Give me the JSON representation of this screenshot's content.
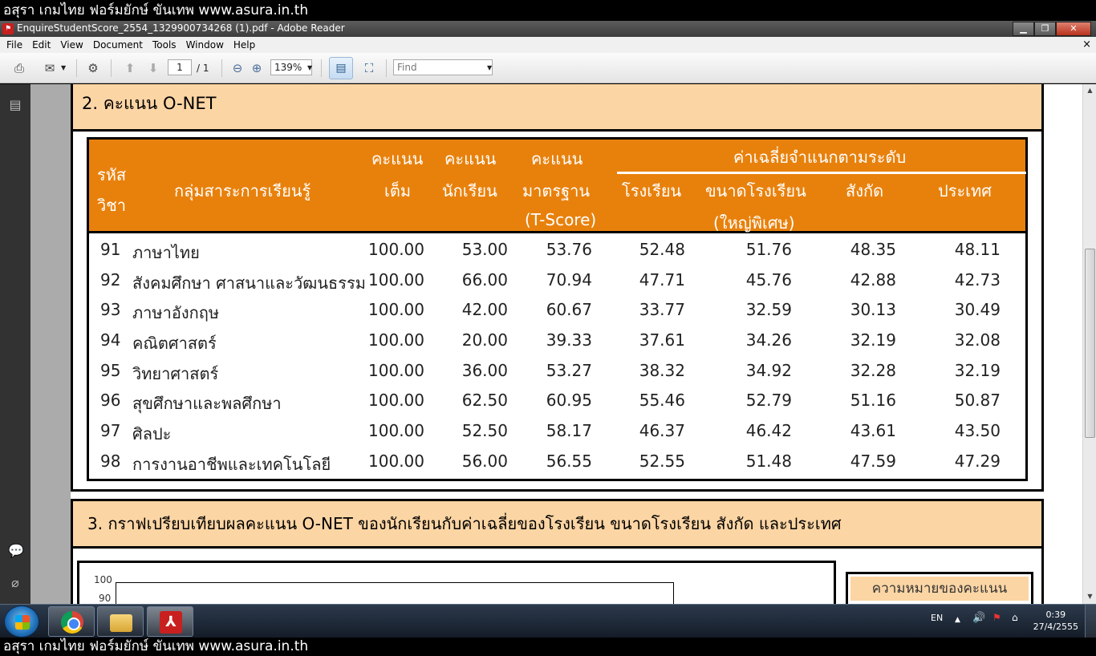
{
  "watermark": {
    "top": "อสุรา เกมไทย ฟอร์มยักษ์ ขันเทพ www.asura.in.th",
    "bottom": "อสุรา เกมไทย ฟอร์มยักษ์ ขันเทพ www.asura.in.th"
  },
  "window": {
    "title": "EnquireStudentScore_2554_1329900734268 (1).pdf - Adobe Reader",
    "minimize": "▁",
    "maximize": "❐",
    "close": "✕"
  },
  "menu": {
    "items": [
      "File",
      "Edit",
      "View",
      "Document",
      "Tools",
      "Window",
      "Help"
    ],
    "close": "×"
  },
  "toolbar": {
    "page_current": "1",
    "page_total": "/ 1",
    "zoom": "139%",
    "find_placeholder": "Find"
  },
  "doc": {
    "section2_title": "2. คะแนน  O-NET",
    "section3_title": "3. กราฟเปรียบเทียบผลคะแนน O-NET ของนักเรียนกับค่าเฉลี่ยของโรงเรียน ขนาดโรงเรียน สังกัด และประเทศ",
    "table": {
      "headers": {
        "code_1": "รหัส",
        "code_2": "วิชา",
        "subject": "กลุ่มสาระการเรียนรู้",
        "full_1": "คะแนน",
        "full_2": "เต็ม",
        "student_1": "คะแนน",
        "student_2": "นักเรียน",
        "std_1": "คะแนน",
        "std_2": "มาตรฐาน",
        "std_3": "(T-Score)",
        "avg_group": "ค่าเฉลี่ยจำแนกตามระดับ",
        "school": "โรงเรียน",
        "size_1": "ขนาดโรงเรียน",
        "size_2": "(ใหญ่พิเศษ)",
        "affiliation": "สังกัด",
        "country": "ประเทศ"
      },
      "rows": [
        {
          "code": "91",
          "subject": "ภาษาไทย",
          "full": "100.00",
          "student": "53.00",
          "tscore": "53.76",
          "school": "52.48",
          "size": "51.76",
          "affiliation": "48.35",
          "country": "48.11"
        },
        {
          "code": "92",
          "subject": "สังคมศึกษา ศาสนาและวัฒนธรรม",
          "full": "100.00",
          "student": "66.00",
          "tscore": "70.94",
          "school": "47.71",
          "size": "45.76",
          "affiliation": "42.88",
          "country": "42.73"
        },
        {
          "code": "93",
          "subject": "ภาษาอังกฤษ",
          "full": "100.00",
          "student": "42.00",
          "tscore": "60.67",
          "school": "33.77",
          "size": "32.59",
          "affiliation": "30.13",
          "country": "30.49"
        },
        {
          "code": "94",
          "subject": "คณิตศาสตร์",
          "full": "100.00",
          "student": "20.00",
          "tscore": "39.33",
          "school": "37.61",
          "size": "34.26",
          "affiliation": "32.19",
          "country": "32.08"
        },
        {
          "code": "95",
          "subject": "วิทยาศาสตร์",
          "full": "100.00",
          "student": "36.00",
          "tscore": "53.27",
          "school": "38.32",
          "size": "34.92",
          "affiliation": "32.28",
          "country": "32.19"
        },
        {
          "code": "96",
          "subject": "สุขศึกษาและพลศึกษา",
          "full": "100.00",
          "student": "62.50",
          "tscore": "60.95",
          "school": "55.46",
          "size": "52.79",
          "affiliation": "51.16",
          "country": "50.87"
        },
        {
          "code": "97",
          "subject": "ศิลปะ",
          "full": "100.00",
          "student": "52.50",
          "tscore": "58.17",
          "school": "46.37",
          "size": "46.42",
          "affiliation": "43.61",
          "country": "43.50"
        },
        {
          "code": "98",
          "subject": "การงานอาชีพและเทคโนโลยี",
          "full": "100.00",
          "student": "56.00",
          "tscore": "56.55",
          "school": "52.55",
          "size": "51.48",
          "affiliation": "47.59",
          "country": "47.29"
        }
      ]
    },
    "chart_axis": {
      "t100": "100",
      "t90": "90"
    },
    "legend_title": "ความหมายของคะแนน"
  },
  "taskbar": {
    "lang": "EN",
    "time": "0:39",
    "date": "27/4/2555"
  },
  "colors": {
    "header_orange": "#e8810c",
    "section_peach": "#fcd5a4"
  }
}
